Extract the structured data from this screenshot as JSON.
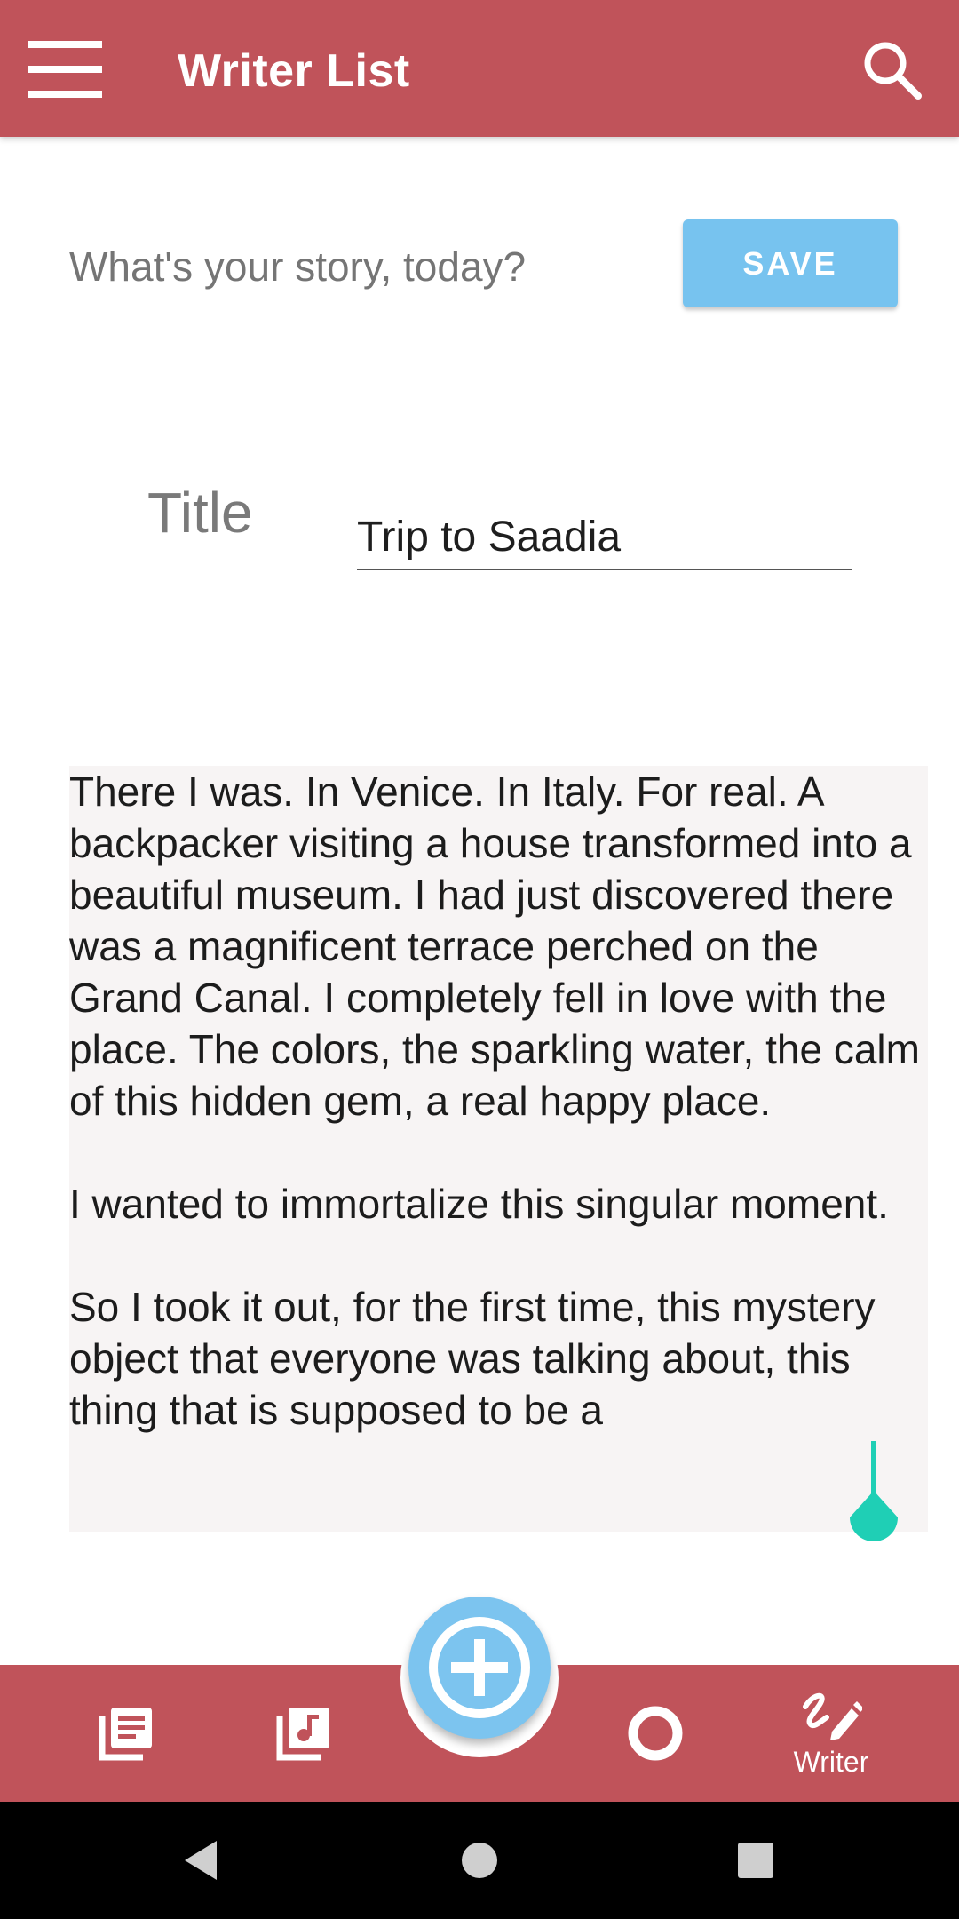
{
  "app_bar": {
    "title": "Writer List",
    "menu_icon": "hamburger-menu-icon",
    "search_icon": "search-icon",
    "color": "#c0535a"
  },
  "editor": {
    "prompt": "What's your story, today?",
    "save_label": "SAVE",
    "save_color": "#77c3ef",
    "title_label": "Title",
    "title_value": "Trip to Saadia",
    "story": "There I was. In Venice. In Italy. For real. A backpacker visiting a house transformed into a beautiful museum. I had just discovered there was a magnificent terrace perched on the Grand Canal. I completely fell in love with the place. The colors, the sparkling water, the calm of this hidden gem, a real happy place.\n\nI wanted to immortalize this singular moment.\n\nSo I took it out, for the first time, this mystery object that everyone was talking about, this thing that is supposed to be a",
    "cursor_color": "#1fcfb5"
  },
  "bottom_nav": {
    "items": [
      {
        "icon": "library-books-icon",
        "label": ""
      },
      {
        "icon": "music-library-icon",
        "label": ""
      },
      {
        "icon": "circle-icon",
        "label": ""
      },
      {
        "icon": "draw-pen-icon",
        "label": "Writer"
      }
    ],
    "fab_icon": "add-circle-icon",
    "fab_color": "#7cc4ef"
  },
  "system_nav": {
    "back_icon": "back-triangle-icon",
    "home_icon": "home-circle-icon",
    "recents_icon": "recents-square-icon"
  }
}
